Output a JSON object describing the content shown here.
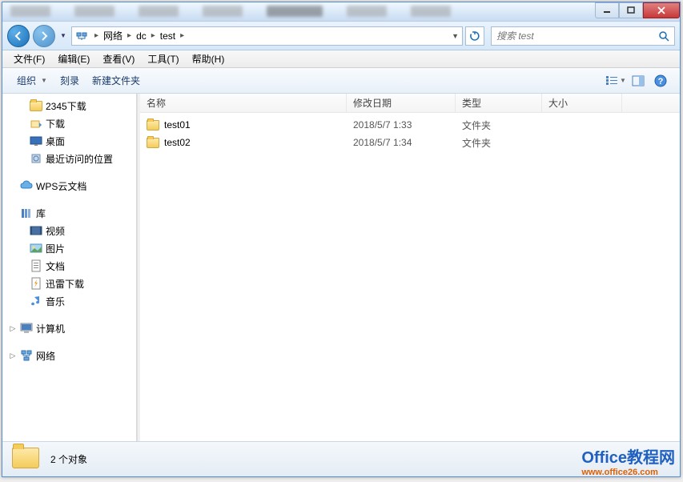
{
  "breadcrumb": {
    "seg1": "网络",
    "seg2": "dc",
    "seg3": "test"
  },
  "search": {
    "placeholder": "搜索 test"
  },
  "menu": {
    "file": "文件(F)",
    "edit": "编辑(E)",
    "view": "查看(V)",
    "tools": "工具(T)",
    "help": "帮助(H)"
  },
  "toolbar": {
    "organize": "组织",
    "burn": "刻录",
    "newfolder": "新建文件夹"
  },
  "columns": {
    "name": "名称",
    "date": "修改日期",
    "type": "类型",
    "size": "大小"
  },
  "sidebar": {
    "items": [
      {
        "label": "2345下载"
      },
      {
        "label": "下载"
      },
      {
        "label": "桌面"
      },
      {
        "label": "最近访问的位置"
      },
      {
        "label": "WPS云文档"
      },
      {
        "label": "库"
      },
      {
        "label": "视频"
      },
      {
        "label": "图片"
      },
      {
        "label": "文档"
      },
      {
        "label": "迅雷下载"
      },
      {
        "label": "音乐"
      },
      {
        "label": "计算机"
      },
      {
        "label": "网络"
      }
    ]
  },
  "files": [
    {
      "name": "test01",
      "date": "2018/5/7 1:33",
      "type": "文件夹"
    },
    {
      "name": "test02",
      "date": "2018/5/7 1:34",
      "type": "文件夹"
    }
  ],
  "status": {
    "text": "2 个对象"
  },
  "watermark": {
    "line1": "Office教程网",
    "line2": "www.office26.com"
  }
}
